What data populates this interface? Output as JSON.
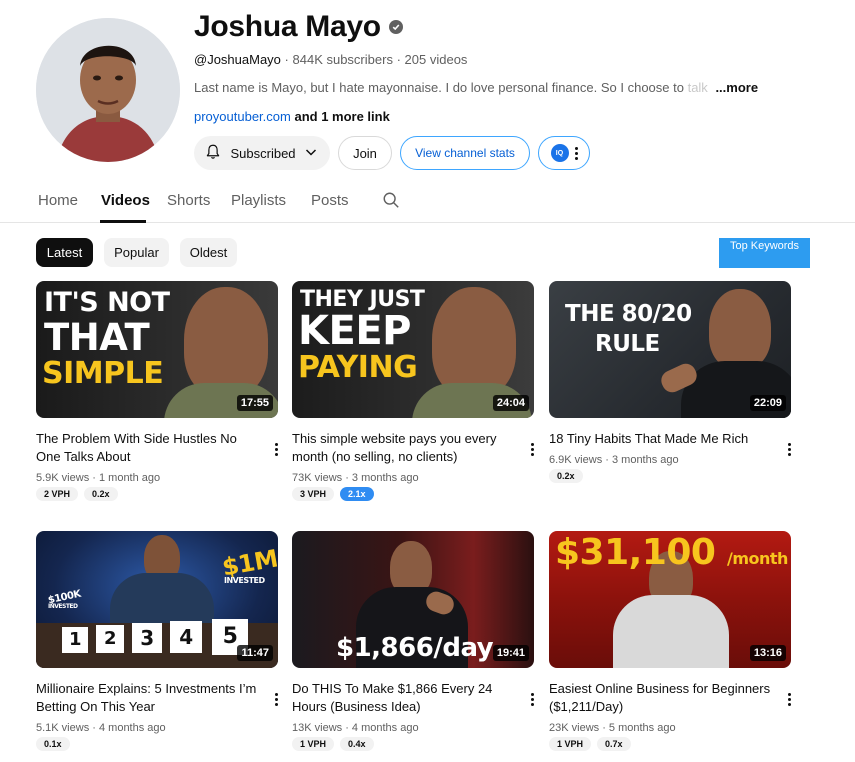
{
  "channel": {
    "name": "Joshua Mayo",
    "handle": "@JoshuaMayo",
    "subscribers": "844K subscribers",
    "videos_count": "205 videos",
    "meta_sep": "·",
    "description_visible": "Last name is Mayo, but I hate mayonnaise. I do love personal finance. So I choose to ",
    "description_faded": "talk",
    "more_label": "...more",
    "link_text": "proyoutuber.com",
    "more_links": "and 1 more link"
  },
  "buttons": {
    "subscribed": "Subscribed",
    "join": "Join",
    "view_stats": "View channel stats",
    "ext_badge": "IQ"
  },
  "tabs": [
    {
      "label": "Home",
      "active": false
    },
    {
      "label": "Videos",
      "active": true
    },
    {
      "label": "Shorts",
      "active": false
    },
    {
      "label": "Playlists",
      "active": false
    },
    {
      "label": "Posts",
      "active": false
    }
  ],
  "filters": {
    "chips": [
      {
        "label": "Latest",
        "active": true
      },
      {
        "label": "Popular",
        "active": false
      },
      {
        "label": "Oldest",
        "active": false
      }
    ],
    "top_keywords": "Top Keywords"
  },
  "videos": [
    {
      "title": "The Problem With Side Hustles No One Talks About",
      "views": "5.9K views",
      "age": "1 month ago",
      "duration": "17:55",
      "badges": [
        {
          "text": "2 VPH",
          "highlight": false
        },
        {
          "text": "0.2x",
          "highlight": false
        }
      ],
      "thumb_lines": [
        "IT'S NOT",
        "THAT",
        "SIMPLE"
      ]
    },
    {
      "title": "This simple website pays you every month (no selling, no clients)",
      "views": "73K views",
      "age": "3 months ago",
      "duration": "24:04",
      "badges": [
        {
          "text": "3 VPH",
          "highlight": false
        },
        {
          "text": "2.1x",
          "highlight": true
        }
      ],
      "thumb_lines": [
        "THEY JUST",
        "KEEP",
        "PAYING"
      ]
    },
    {
      "title": "18 Tiny Habits That Made Me Rich",
      "views": "6.9K views",
      "age": "3 months ago",
      "duration": "22:09",
      "badges": [
        {
          "text": "0.2x",
          "highlight": false
        }
      ],
      "thumb_lines": [
        "THE 80/20",
        "RULE"
      ]
    },
    {
      "title": "Millionaire Explains: 5 Investments I’m Betting On This Year",
      "views": "5.1K views",
      "age": "4 months ago",
      "duration": "11:47",
      "badges": [
        {
          "text": "0.1x",
          "highlight": false
        }
      ],
      "thumb_lines": [
        "$1M",
        "INVESTED",
        "$100K",
        "INVESTED",
        "1",
        "2",
        "3",
        "4",
        "5"
      ]
    },
    {
      "title": "Do THIS To Make $1,866 Every 24 Hours (Business Idea)",
      "views": "13K views",
      "age": "4 months ago",
      "duration": "19:41",
      "badges": [
        {
          "text": "1 VPH",
          "highlight": false
        },
        {
          "text": "0.4x",
          "highlight": false
        }
      ],
      "thumb_lines": [
        "$1,866/day"
      ]
    },
    {
      "title": "Easiest Online Business for Beginners ($1,211/Day)",
      "views": "23K views",
      "age": "5 months ago",
      "duration": "13:16",
      "badges": [
        {
          "text": "1 VPH",
          "highlight": false
        },
        {
          "text": "0.7x",
          "highlight": false
        }
      ],
      "thumb_lines": [
        "$31,100",
        "/month"
      ]
    }
  ],
  "icons": {
    "verified": "verified-check-icon",
    "bell": "bell-icon",
    "chevron": "chevron-down-icon",
    "search": "search-icon",
    "more": "more-vert-icon"
  }
}
